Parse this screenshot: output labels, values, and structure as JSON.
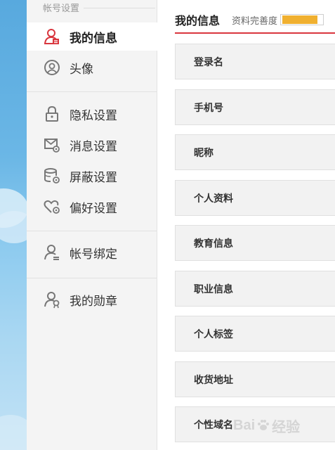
{
  "sidebar": {
    "group_title": "帐号设置",
    "items": [
      {
        "label": "我的信息",
        "icon": "user-red-icon",
        "active": true
      },
      {
        "label": "头像",
        "icon": "avatar-circle-icon"
      },
      {
        "label": "隐私设置",
        "icon": "lock-icon"
      },
      {
        "label": "消息设置",
        "icon": "mail-gear-icon"
      },
      {
        "label": "屏蔽设置",
        "icon": "block-gear-icon"
      },
      {
        "label": "偏好设置",
        "icon": "heart-gear-icon"
      },
      {
        "label": "帐号绑定",
        "icon": "user-link-icon"
      },
      {
        "label": "我的勋章",
        "icon": "user-medal-icon"
      }
    ]
  },
  "main": {
    "title": "我的信息",
    "completion_label": "资料完善度",
    "completion_value": 0.9,
    "rows": [
      "登录名",
      "手机号",
      "昵称",
      "个人资料",
      "教育信息",
      "职业信息",
      "个人标签",
      "收货地址",
      "个性域名"
    ]
  },
  "watermark": {
    "text": "Bai",
    "text2": "经验"
  },
  "colors": {
    "accent": "#d9363e",
    "progress": "#f0b030",
    "sky": "#6bb7e6"
  }
}
